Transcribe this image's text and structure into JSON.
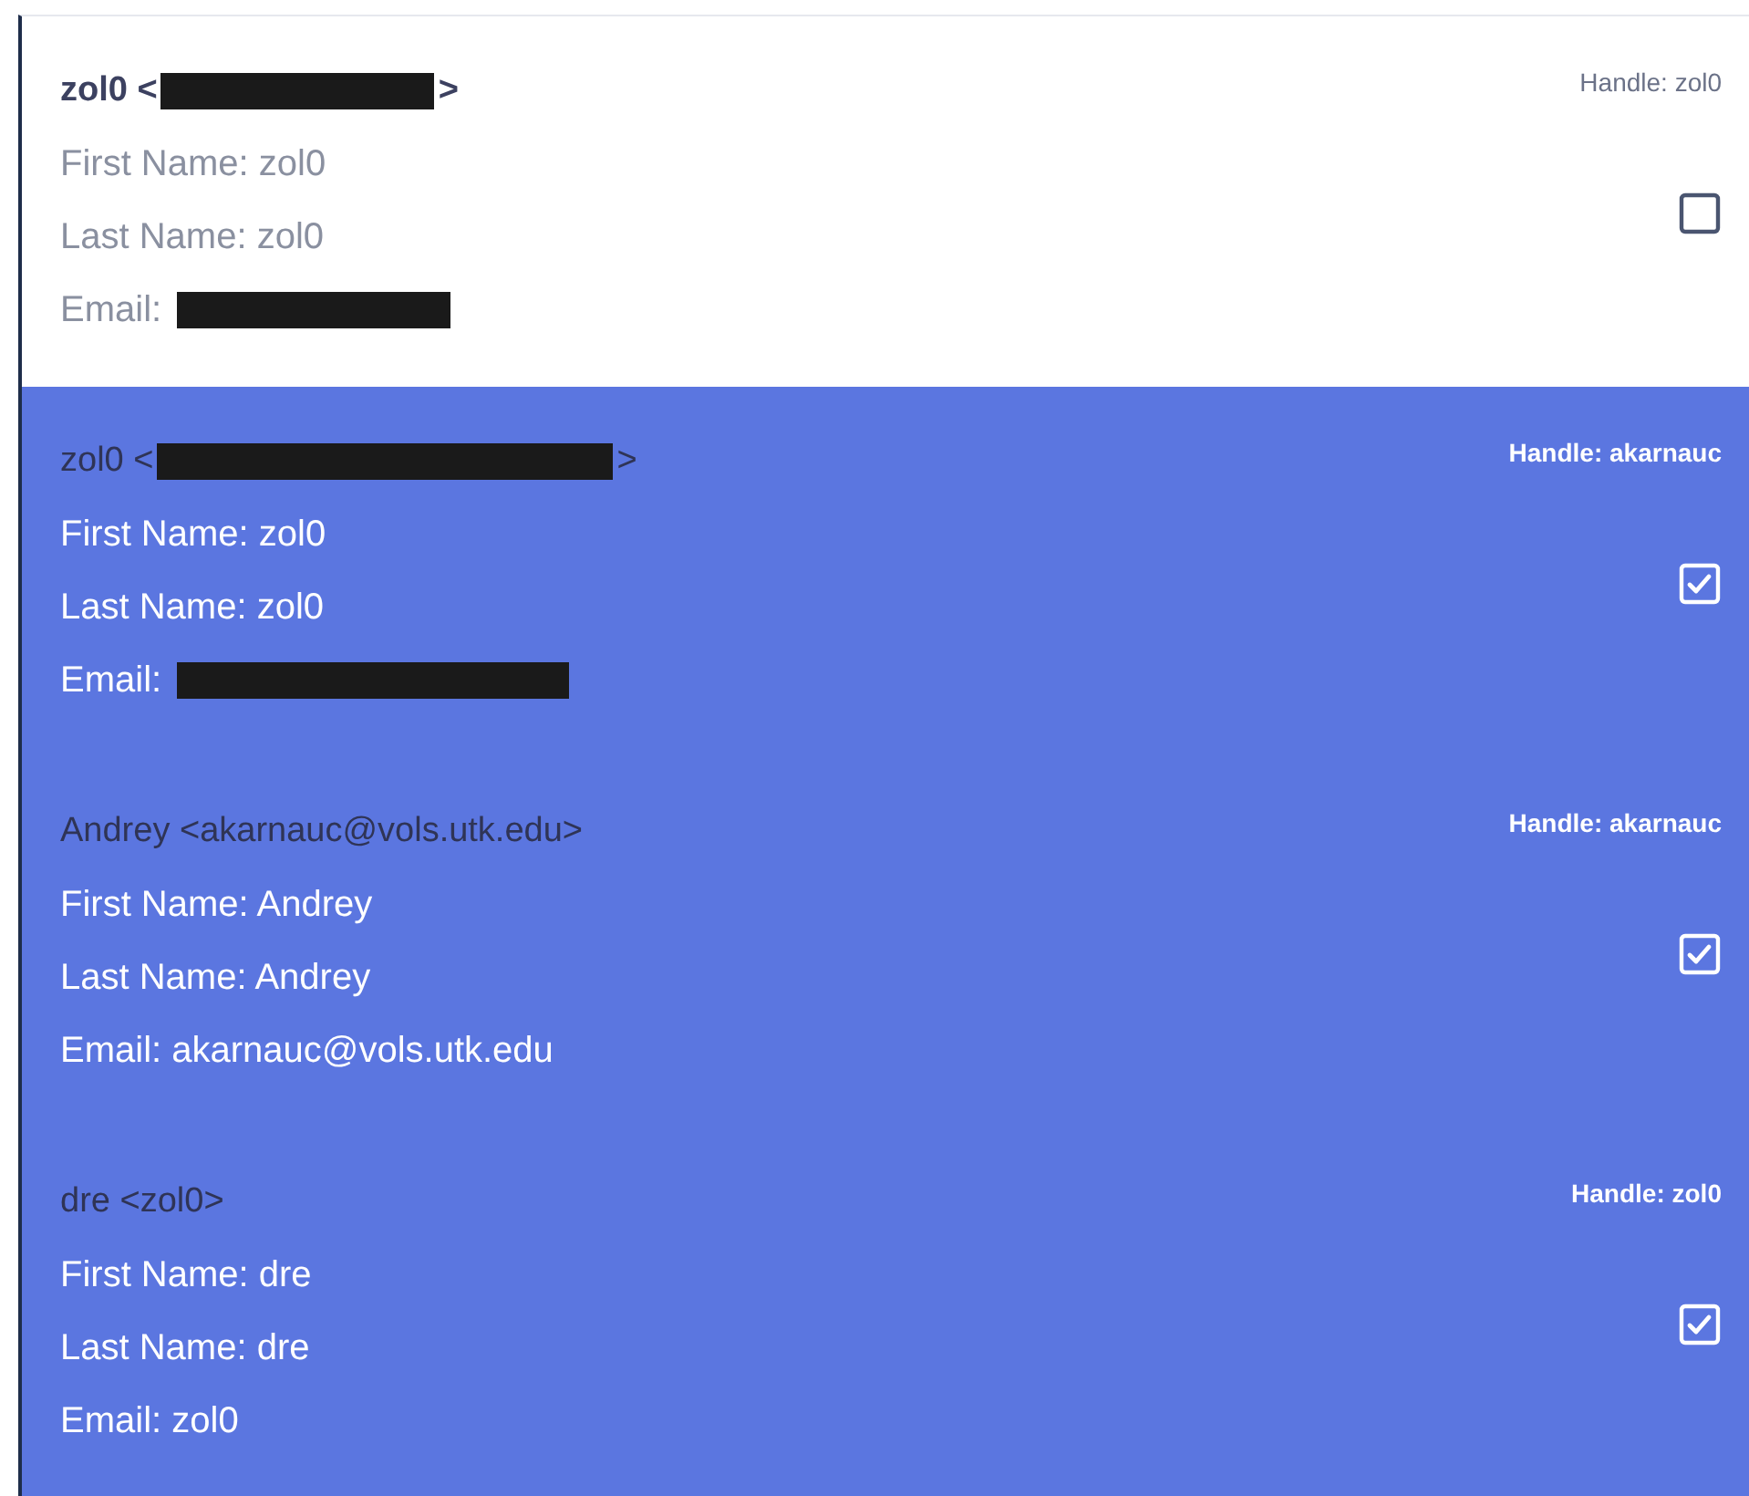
{
  "users": [
    {
      "name": "zol0 <",
      "name_redacted": true,
      "name_end": ">",
      "first_name": "First Name: zol0",
      "last_name": "Last Name: zol0",
      "email": "Email:",
      "email_redacted": true,
      "handle": "Handle: zol0",
      "checked": false,
      "selected": false
    },
    {
      "name": "zol0 <",
      "name_redacted": true,
      "name_end": ">",
      "first_name": "First Name: zol0",
      "last_name": "Last Name: zol0",
      "email": "Email:",
      "email_redacted": true,
      "handle": "Handle: akarnauc",
      "checked": true,
      "selected": true
    },
    {
      "name": "Andrey <akarnauc@vols.utk.edu>",
      "name_redacted": false,
      "first_name": "First Name: Andrey",
      "last_name": "Last Name: Andrey",
      "email": "Email: akarnauc@vols.utk.edu",
      "email_redacted": false,
      "handle": "Handle: akarnauc",
      "checked": true,
      "selected": true
    },
    {
      "name": "dre <zol0>",
      "name_redacted": false,
      "first_name": "First Name: dre",
      "last_name": "Last Name: dre",
      "email": "Email: zol0",
      "email_redacted": false,
      "handle": "Handle: zol0",
      "checked": true,
      "selected": true
    }
  ]
}
